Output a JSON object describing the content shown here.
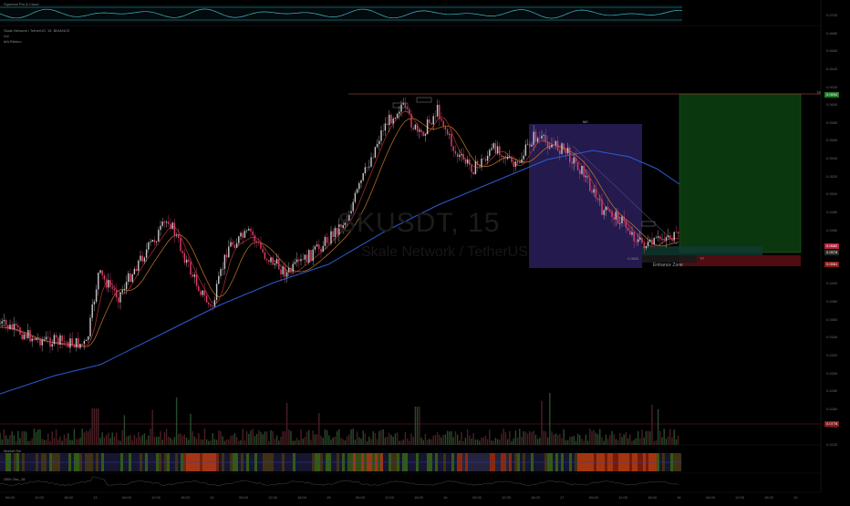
{
  "watermark": {
    "symbol": "SKUSDT, 15",
    "subtitle": "Skale Network / TetherUS"
  },
  "legend": {
    "main": "Skale Network / TetherUS, 15, BINANCE",
    "line2": "Vol",
    "line3": "MA Ribbon"
  },
  "top_indicator_label": "Squeeze Pro & Cloud",
  "pane_labels": {
    "rsi": "Market Rsi",
    "obv": "OBV Osc_18"
  },
  "drawings": {
    "zone_marker": "M2",
    "entrance_zone": "Entrance Zone",
    "long_box_label": "TP",
    "fib_left_label": "0.0563",
    "fib_right_label": "TP"
  },
  "price_axis_labels": [
    "0.0700",
    "0.0680",
    "0.0660",
    "0.0640",
    "0.0620",
    "0.0600",
    "0.0580",
    "0.0560",
    "0.0540",
    "0.0520",
    "0.0500",
    "0.0480",
    "0.0460",
    "0.0440",
    "0.0420",
    "0.0400",
    "0.0380",
    "0.0360",
    "0.0340",
    "0.0320",
    "0.0300",
    "0.0280",
    "0.0260",
    "0.0240",
    "0.0220"
  ],
  "price_tags": {
    "target": "0.0694",
    "current": "0.0582",
    "entry": "0.0578",
    "stop": "0.0561",
    "vol_tag": "0.0778"
  },
  "time_axis_labels": [
    "06:00",
    "12:00",
    "18:00",
    "13",
    "06:00",
    "12:00",
    "18:00",
    "14",
    "06:00",
    "12:00",
    "18:00",
    "15",
    "06:00",
    "12:00",
    "18:00",
    "16",
    "06:00",
    "12:00",
    "18:00",
    "17",
    "06:00",
    "12:00",
    "18:00",
    "18",
    "06:00",
    "12:00",
    "18:00",
    "19"
  ],
  "colors": {
    "background": "#000000",
    "candle_up": "#c8c8c8",
    "candle_down": "#e0406a",
    "ma_blue": "#2c5bd1",
    "ma_orange": "#c97a28",
    "ma_red": "#b8332e",
    "zone_purple": "#2d2160",
    "long_green": "#0f3d12",
    "short_red": "#5a0f12",
    "resistance": "#8a3f2a"
  }
}
